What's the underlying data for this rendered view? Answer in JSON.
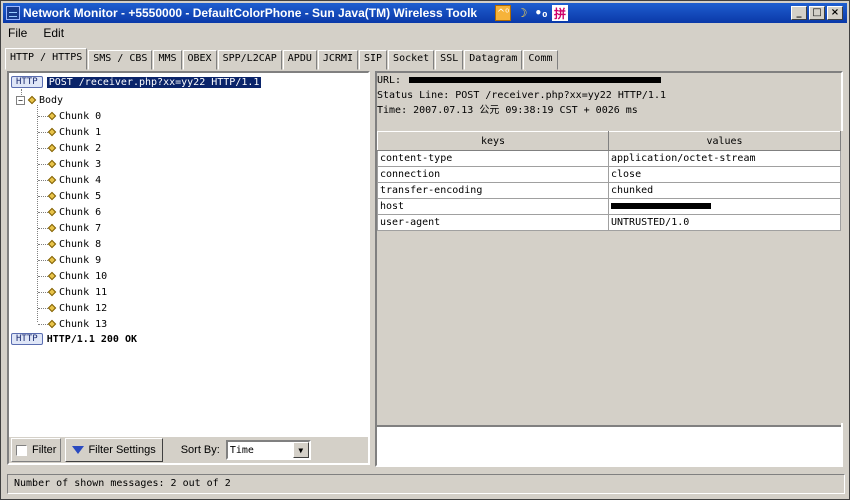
{
  "window": {
    "title": "Network Monitor - +5550000 - DefaultColorPhone - Sun Java(TM) Wireless Toolk",
    "controls": [
      "_",
      "□",
      "×"
    ]
  },
  "tray_glyphs": [
    "^⁰",
    "☽",
    "•₀",
    "拼"
  ],
  "menu": [
    "File",
    "Edit"
  ],
  "tabs": [
    "HTTP / HTTPS",
    "SMS / CBS",
    "MMS",
    "OBEX",
    "SPP/L2CAP",
    "APDU",
    "JCRMI",
    "SIP",
    "Socket",
    "SSL",
    "Datagram",
    "Comm"
  ],
  "tree": {
    "request_badge": "HTTP",
    "request_label": "POST /receiver.php?xx=yy22 HTTP/1.1",
    "body_label": "Body",
    "chunks": [
      "Chunk 0",
      "Chunk 1",
      "Chunk 2",
      "Chunk 3",
      "Chunk 4",
      "Chunk 5",
      "Chunk 6",
      "Chunk 7",
      "Chunk 8",
      "Chunk 9",
      "Chunk 10",
      "Chunk 11",
      "Chunk 12",
      "Chunk 13"
    ],
    "response_badge": "HTTP",
    "response_label": "HTTP/1.1 200 OK"
  },
  "left_bottom": {
    "filter_label": "Filter",
    "filter_settings_label": "Filter Settings",
    "sort_by_label": "Sort By:",
    "sort_value": "Time"
  },
  "details": {
    "url_label": "URL:",
    "status_line": "Status Line: POST /receiver.php?xx=yy22 HTTP/1.1",
    "time": "Time: 2007.07.13 公元  09:38:19 CST + 0026 ms"
  },
  "headers_table": {
    "columns": [
      "keys",
      "values"
    ],
    "rows": [
      {
        "key": "content-type",
        "value": "application/octet-stream"
      },
      {
        "key": "connection",
        "value": "close"
      },
      {
        "key": "transfer-encoding",
        "value": "chunked"
      },
      {
        "key": "host",
        "value": ""
      },
      {
        "key": "user-agent",
        "value": "UNTRUSTED/1.0"
      }
    ]
  },
  "status_bar": "Number of shown messages: 2 out of 2"
}
